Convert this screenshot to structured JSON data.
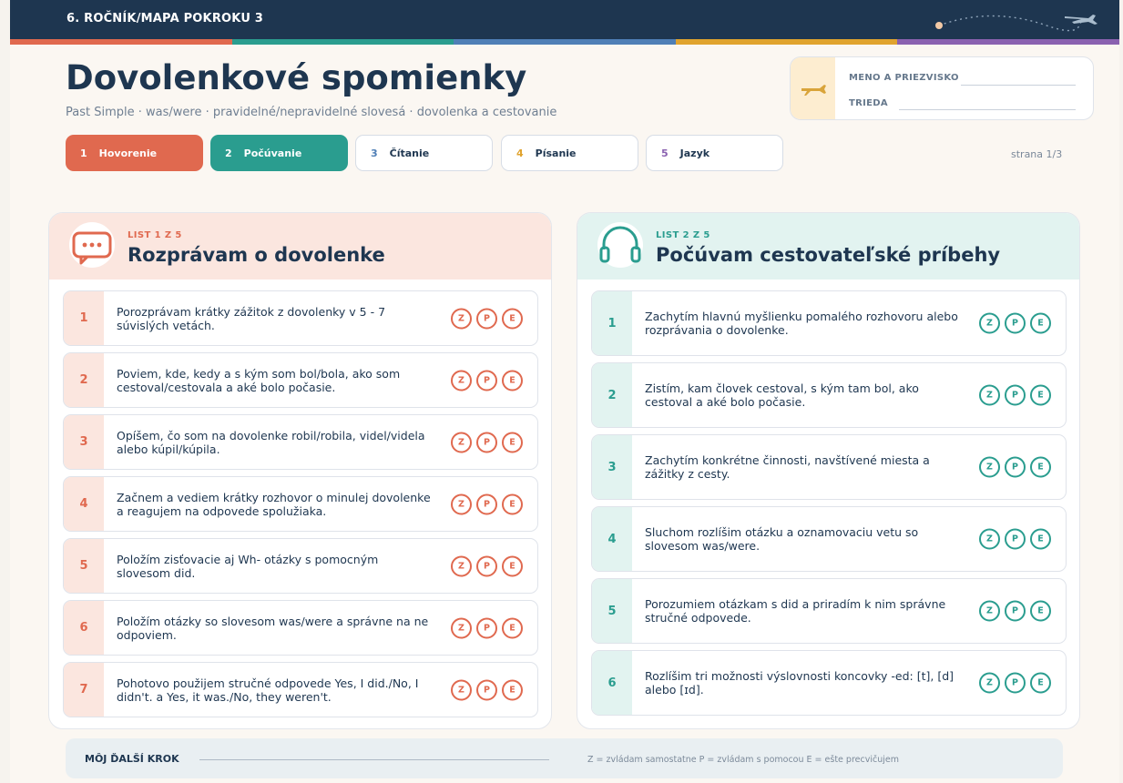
{
  "header": {
    "crumb": "6. ROČNÍK/MAPA POKROKU 3"
  },
  "colors": {
    "coral": "#e0694f",
    "teal": "#2a9d8f",
    "blue": "#4f7fb6",
    "gold": "#e0a32e",
    "purple": "#8a61b0",
    "navy": "#1e3650"
  },
  "title": "Dovolenkové spomienky",
  "subtitle": "Past Simple · was/were · pravidelné/nepravidelné slovesá · dovolenka a cestovanie",
  "namebox": {
    "icon": "airplane-icon",
    "name_label": "MENO A PRIEZVISKO",
    "class_label": "TRIEDA"
  },
  "tabs": [
    {
      "num": "1",
      "label": "Hovorenie"
    },
    {
      "num": "2",
      "label": "Počúvanie"
    },
    {
      "num": "3",
      "label": "Čítanie"
    },
    {
      "num": "4",
      "label": "Písanie"
    },
    {
      "num": "5",
      "label": "Jazyk"
    }
  ],
  "page_number": "strana 1/3",
  "speaking": {
    "icon": "speech-bubble-icon",
    "kicker": "LIST 1 Z 5",
    "title": "Rozprávam o dovolenke",
    "items": [
      {
        "num": "1",
        "text": "Porozprávam krátky zážitok z dovolenky v 5 - 7 súvislých vetách."
      },
      {
        "num": "2",
        "text": "Poviem, kde, kedy a s kým som bol/bola, ako som cestoval/cestovala a aké bolo počasie."
      },
      {
        "num": "3",
        "text": "Opíšem, čo som na dovolenke robil/robila, videl/videla alebo kúpil/kúpila."
      },
      {
        "num": "4",
        "text": "Začnem a vediem krátky rozhovor o minulej dovolenke a reagujem na odpovede spolužiaka."
      },
      {
        "num": "5",
        "text": "Položím zisťovacie aj Wh- otázky s pomocným slovesom did."
      },
      {
        "num": "6",
        "text": "Položím otázky so slovesom was/were a správne na ne odpoviem."
      },
      {
        "num": "7",
        "text": "Pohotovo použijem stručné odpovede Yes, I did./No, I didn't. a Yes, it was./No, they weren't."
      }
    ]
  },
  "listening": {
    "icon": "headphones-icon",
    "kicker": "LIST 2 Z 5",
    "title": "Počúvam cestovateľské príbehy",
    "items": [
      {
        "num": "1",
        "text": "Zachytím hlavnú myšlienku pomalého rozhovoru alebo rozprávania o dovolenke."
      },
      {
        "num": "2",
        "text": "Zistím, kam človek cestoval, s kým tam bol, ako cestoval a aké bolo počasie."
      },
      {
        "num": "3",
        "text": "Zachytím konkrétne činnosti, navštívené miesta a zážitky z cesty."
      },
      {
        "num": "4",
        "text": "Sluchom rozlíšim otázku a oznamovaciu vetu so slovesom was/were."
      },
      {
        "num": "5",
        "text": "Porozumiem otázkam s did a priradím k nim správne stručné odpovede."
      },
      {
        "num": "6",
        "text": "Rozlíšim tri možnosti výslovnosti koncovky -ed: [t], [d] alebo [ɪd]."
      }
    ]
  },
  "rating_letters": [
    "Z",
    "P",
    "E"
  ],
  "footer": {
    "label": "MÔJ ĎALŠÍ KROK",
    "legend": "Z = zvládam samostatne   P = zvládam s pomocou   E = ešte precvičujem"
  }
}
